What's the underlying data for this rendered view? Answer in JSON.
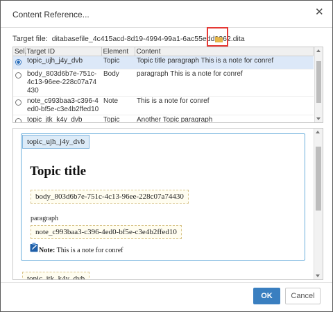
{
  "dialog": {
    "title": "Content Reference...",
    "close": "✕"
  },
  "target": {
    "label": "Target file:",
    "value": "ditabasefile_4c415acd-8d19-4994-99a1-6ac55edd9362.dita"
  },
  "table": {
    "headers": [
      "Sel.",
      "Target ID",
      "Element",
      "Content"
    ],
    "rows": [
      {
        "id": "topic_ujh_j4y_dvb",
        "element": "Topic",
        "content": "Topic title paragraph This is a note for conref",
        "selected": true
      },
      {
        "id": "body_803d6b7e-751c-4c13-96ee-228c07a74430",
        "element": "Body",
        "content": "paragraph This is a note for conref",
        "selected": false
      },
      {
        "id": "note_c993baa3-c396-4ed0-bf5e-c3e4b2ffed10",
        "element": "Note",
        "content": "This is a note for conref",
        "selected": false
      },
      {
        "id": "topic_jtk_k4y_dvb",
        "element": "Topic",
        "content": "Another Topic paragraph",
        "selected": false
      }
    ]
  },
  "preview": {
    "topic_tag": "topic_ujh_j4y_dvb",
    "heading": "Topic title",
    "body_tag": "body_803d6b7e-751c-4c13-96ee-228c07a74430",
    "paragraph": "paragraph",
    "note_tag": "note_c993baa3-c396-4ed0-bf5e-c3e4b2ffed10",
    "note_label": "Note:",
    "note_text": "This is a note for conref",
    "partial_tag": "topic_jtk_k4y_dvb"
  },
  "buttons": {
    "ok": "OK",
    "cancel": "Cancel"
  },
  "colors": {
    "accent": "#3a7fc0",
    "highlight": "#e53935",
    "selected_row": "#dce8f8"
  }
}
